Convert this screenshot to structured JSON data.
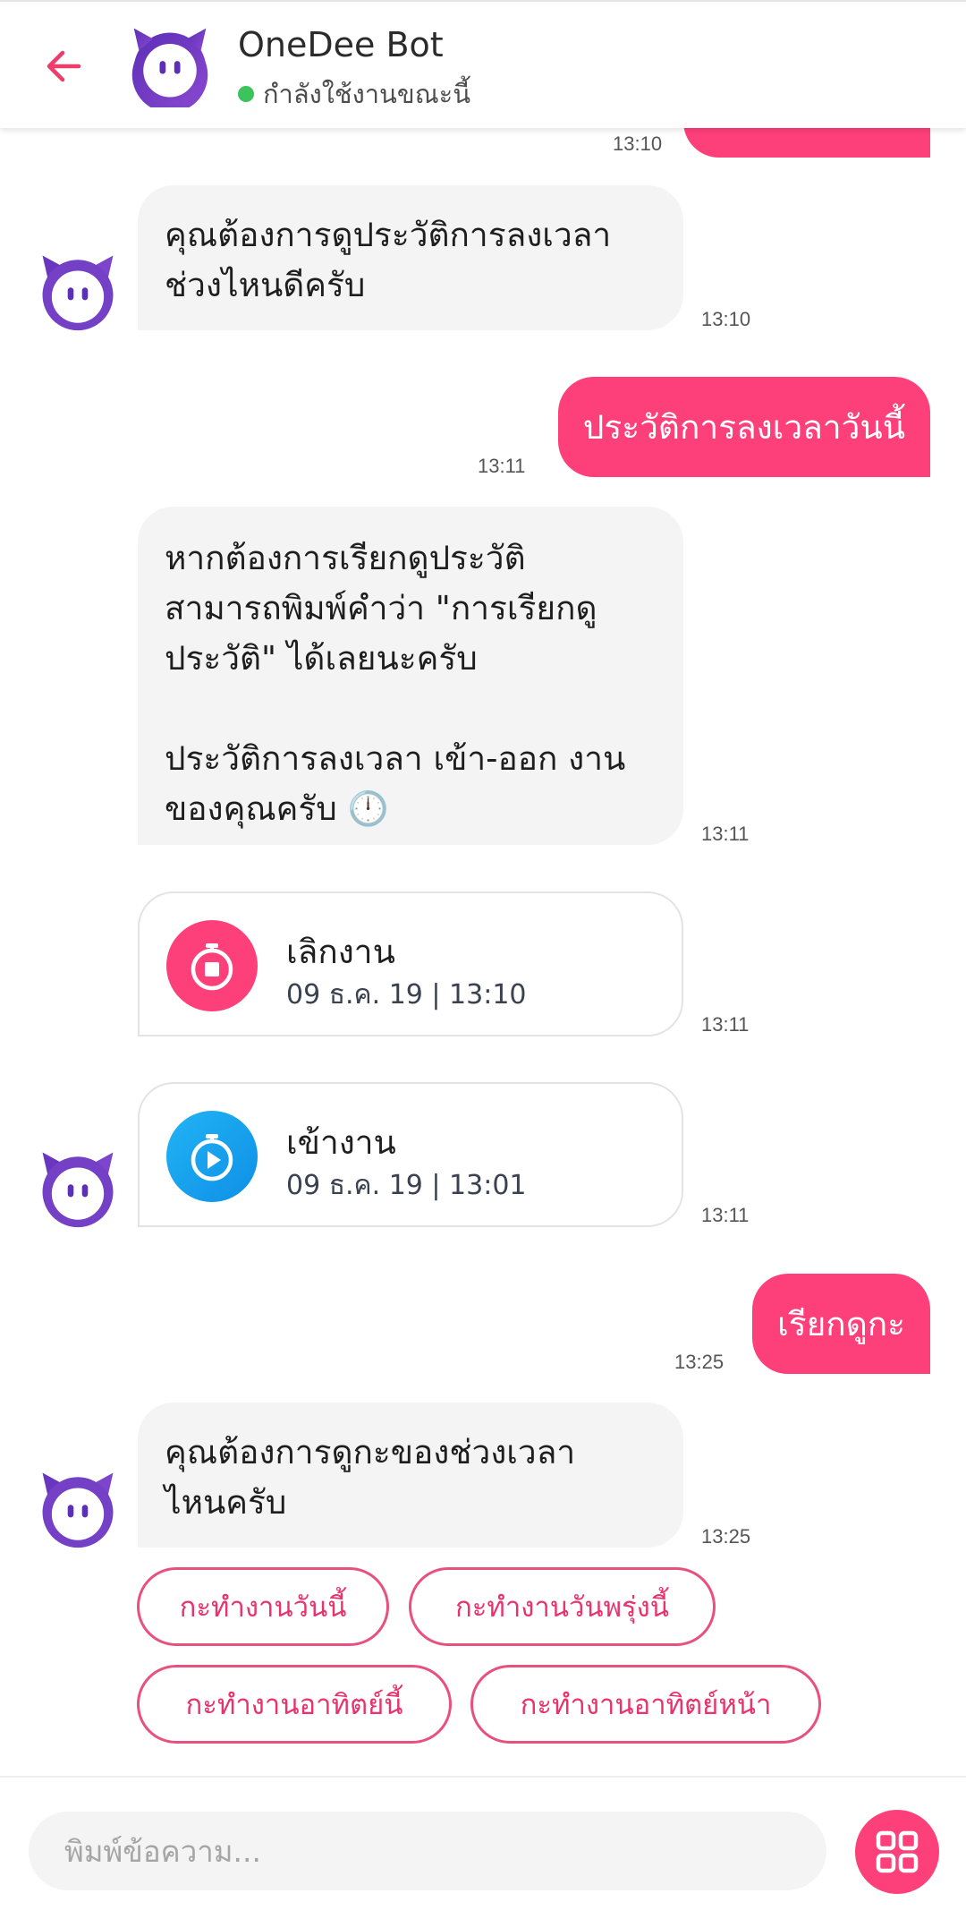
{
  "header": {
    "title": "OneDee Bot",
    "status": "กำลังใช้งานขณะนี้"
  },
  "messages": {
    "m0_time": "13:10",
    "m1_text": "คุณต้องการดูประวัติการลงเวลา\nช่วงไหนดีครับ",
    "m1_time": "13:10",
    "m2_text": "ประวัติการลงเวลาวันนี้",
    "m2_time": "13:11",
    "m3_text": "หากต้องการเรียกดูประวัติ\nสามารถพิมพ์คำว่า \"การเรียกดู\nประวัติ\" ได้เลยนะครับ\n\nประวัติการลงเวลา เข้า-ออก งาน\nของคุณครับ 🕛",
    "m3_time": "13:11",
    "card1_title": "เลิกงาน",
    "card1_sub": "09 ธ.ค. 19 | 13:10",
    "card1_time": "13:11",
    "card2_title": "เข้างาน",
    "card2_sub": "09 ธ.ค. 19 | 13:01",
    "card2_time": "13:11",
    "m4_text": "เรียกดูกะ",
    "m4_time": "13:25",
    "m5_text": "คุณต้องการดูกะของช่วงเวลา\nไหนครับ",
    "m5_time": "13:25"
  },
  "quick_replies": [
    "กะทำงานวันนี้",
    "กะทำงานวันพรุ่งนี้",
    "กะทำงานอาทิตย์นี้",
    "กะทำงานอาทิตย์หน้า"
  ],
  "composer": {
    "placeholder": "พิมพ์ข้อความ..."
  },
  "colors": {
    "accent": "#fd3f7a",
    "bot_avatar": "#7a3fc4",
    "stop_icon": "#fd3f7a",
    "start_icon": "#1aa6f0"
  }
}
